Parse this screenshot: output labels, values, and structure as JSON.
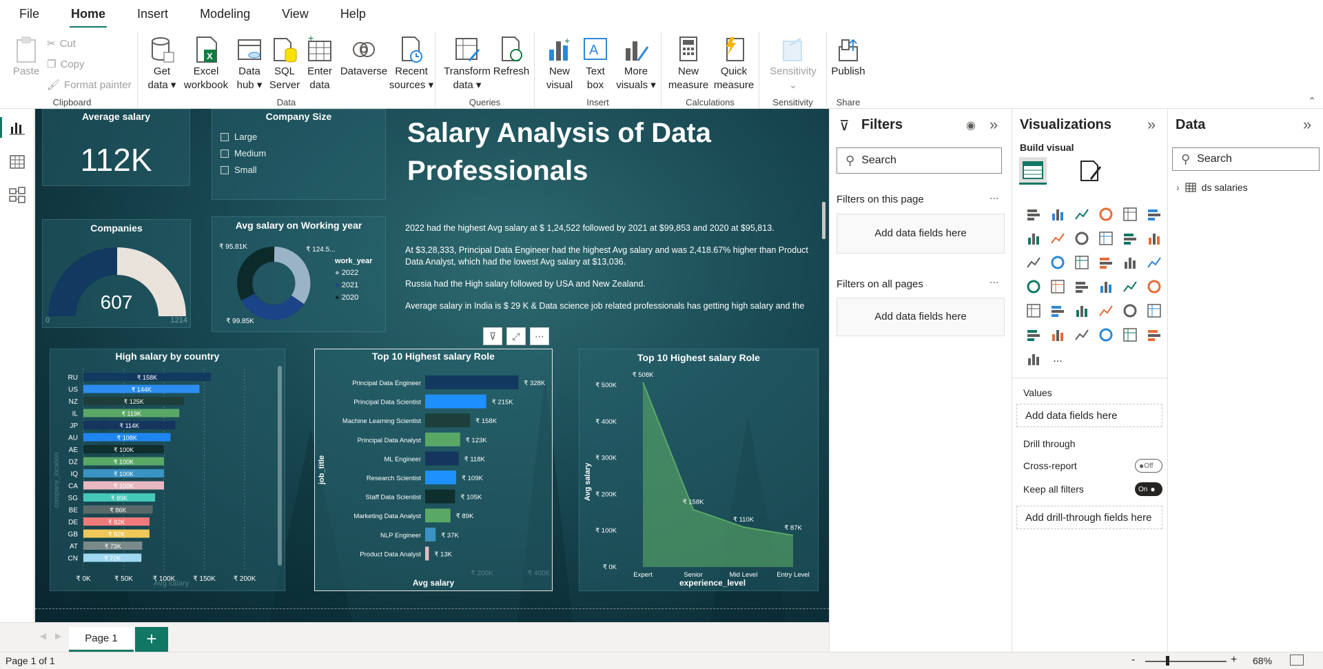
{
  "menu": [
    "File",
    "Home",
    "Insert",
    "Modeling",
    "View",
    "Help"
  ],
  "ribbon": {
    "clipboard": {
      "label": "Clipboard",
      "paste": "Paste",
      "cut": "Cut",
      "copy": "Copy",
      "format_painter": "Format painter"
    },
    "data": {
      "label": "Data",
      "get_data": [
        "Get",
        "data"
      ],
      "excel": [
        "Excel",
        "workbook"
      ],
      "data_hub": [
        "Data",
        "hub"
      ],
      "sql": [
        "SQL",
        "Server"
      ],
      "enter": [
        "Enter",
        "data"
      ],
      "dataverse": "Dataverse",
      "recent": [
        "Recent",
        "sources"
      ]
    },
    "queries": {
      "label": "Queries",
      "transform": [
        "Transform",
        "data"
      ],
      "refresh": "Refresh"
    },
    "insert": {
      "label": "Insert",
      "new_visual": [
        "New",
        "visual"
      ],
      "text_box": [
        "Text",
        "box"
      ],
      "more_visuals": [
        "More",
        "visuals"
      ]
    },
    "calculations": {
      "label": "Calculations",
      "new_measure": [
        "New",
        "measure"
      ],
      "quick_measure": [
        "Quick",
        "measure"
      ]
    },
    "sensitivity": {
      "label": "Sensitivity",
      "btn": "Sensitivity"
    },
    "share": {
      "label": "Share",
      "publish": "Publish"
    }
  },
  "dashboard": {
    "title": "Salary Analysis of Data Professionals",
    "avg_salary": {
      "title": "Average salary",
      "value": "112K"
    },
    "company_size": {
      "title": "Company Size",
      "options": [
        "Large",
        "Medium",
        "Small"
      ]
    },
    "companies": {
      "title": "Companies",
      "value": "607",
      "min": "0",
      "max": "1214"
    },
    "working_year": {
      "title": "Avg salary on Working year",
      "legend_title": "work_year",
      "legend": [
        "2022",
        "2021",
        "2020"
      ],
      "labels": [
        "₹ 95.81K",
        "₹ 124.5...",
        "₹ 99.85K"
      ]
    },
    "narrative": [
      "2022 had the highest Avg salary at $ 1,24,522 followed by 2021 at $99,853 and 2020 at $95,813.",
      "At $3,28,333, Principal Data Engineer had the highest Avg salary and was 2,418.67% higher than Product Data Analyst, which had the lowest Avg salary at $13,036.",
      "Russia had the High salary followed by USA and New Zealand.",
      "Average salary in India is $ 29 K & Data science job related professionals has getting high salary and the"
    ]
  },
  "chart_data": [
    {
      "type": "bar",
      "title": "High salary by country",
      "xlabel": "Avg salary",
      "ylabel": "company_location",
      "xlim": [
        0,
        200
      ],
      "x_ticks": [
        "₹ 0K",
        "₹ 50K",
        "₹ 100K",
        "₹ 150K",
        "₹ 200K"
      ],
      "categories": [
        "RU",
        "US",
        "NZ",
        "IL",
        "JP",
        "AU",
        "AE",
        "DZ",
        "IQ",
        "CA",
        "SG",
        "BE",
        "DE",
        "GB",
        "AT",
        "CN"
      ],
      "values": [
        158,
        144,
        125,
        119,
        114,
        108,
        100,
        100,
        100,
        100,
        89,
        86,
        82,
        82,
        73,
        72
      ],
      "labels": [
        "₹ 158K",
        "₹ 144K",
        "₹ 125K",
        "₹ 119K",
        "₹ 114K",
        "₹ 108K",
        "₹ 100K",
        "₹ 100K",
        "₹ 100K",
        "₹ 100K",
        "₹ 89K",
        "₹ 86K",
        "₹ 82K",
        "₹ 82K",
        "₹ 73K",
        "₹ 72K"
      ],
      "colors": [
        "#12395f",
        "#2b8ef0",
        "#1d3e3a",
        "#5aa866",
        "#15355f",
        "#1f86f0",
        "#0f2e2e",
        "#5aa866",
        "#3a93c2",
        "#e8b8c0",
        "#45c8b8",
        "#5a6a6a",
        "#f07a7a",
        "#f0c85a",
        "#7a8a8a",
        "#9fd8f0"
      ]
    },
    {
      "type": "bar",
      "title": "Top 10 Highest salary Role",
      "xlabel": "Avg salary",
      "ylabel": "job_title",
      "xlim": [
        0,
        400
      ],
      "x_ticks": [
        "₹ 200K",
        "₹ 400K"
      ],
      "categories": [
        "Principal Data Engineer",
        "Principal Data Scientist",
        "Machine Learning Scientist",
        "Principal Data Analyst",
        "ML Engineer",
        "Research Scientist",
        "Staff Data Scientist",
        "Marketing Data Analyst",
        "NLP Engineer",
        "Product Data Analyst"
      ],
      "values": [
        328,
        215,
        158,
        123,
        118,
        109,
        105,
        89,
        37,
        13
      ],
      "labels": [
        "₹ 328K",
        "₹ 215K",
        "₹ 158K",
        "₹ 123K",
        "₹ 118K",
        "₹ 109K",
        "₹ 105K",
        "₹ 89K",
        "₹ 37K",
        "₹ 13K"
      ],
      "colors": [
        "#12395f",
        "#1e90ff",
        "#1d3e3a",
        "#5aa866",
        "#15355f",
        "#1e90ff",
        "#0f2e2e",
        "#5aa866",
        "#3a93c2",
        "#e8b8c0"
      ]
    },
    {
      "type": "area",
      "title": "Top 10 Highest salary Role",
      "xlabel": "experience_level",
      "ylabel": "Avg salary",
      "ylim": [
        0,
        500
      ],
      "y_ticks": [
        "₹ 0K",
        "₹ 100K",
        "₹ 200K",
        "₹ 300K",
        "₹ 400K",
        "₹ 500K"
      ],
      "categories": [
        "Expert",
        "Senior",
        "Mid Level",
        "Entry Level"
      ],
      "values": [
        508,
        158,
        110,
        87
      ],
      "labels": [
        "₹ 508K",
        "₹ 158K",
        "₹ 110K",
        "₹ 87K"
      ]
    }
  ],
  "tabs": {
    "page1": "Page 1",
    "add": "+"
  },
  "status": {
    "page": "Page 1 of 1",
    "zoom": "68%",
    "minus": "-",
    "plus": "+"
  },
  "filters": {
    "title": "Filters",
    "search": "Search",
    "on_page": "Filters on this page",
    "on_all": "Filters on all pages",
    "add": "Add data fields here",
    "more": "..."
  },
  "viz": {
    "title": "Visualizations",
    "build": "Build visual",
    "values": "Values",
    "add_values": "Add data fields here",
    "drill": "Drill through",
    "cross": "Cross-report",
    "cross_state": "Off",
    "keep": "Keep all filters",
    "keep_state": "On",
    "add_drill": "Add drill-through fields here",
    "more": "..."
  },
  "datapane": {
    "title": "Data",
    "search": "Search",
    "table": "ds salaries"
  }
}
